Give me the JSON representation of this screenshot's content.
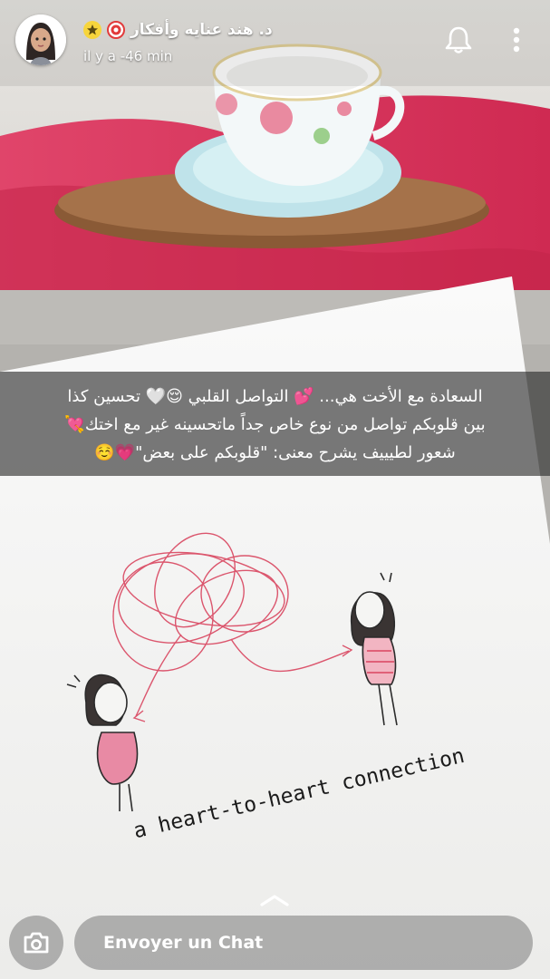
{
  "header": {
    "username": "د. هند عنايه وأفكار",
    "timestamp": "il y a -46 min",
    "avatar_icon": "bitmoji-avatar",
    "badges": [
      "target-icon",
      "star-icon"
    ],
    "actions": [
      "bell-icon",
      "more-vert-icon"
    ]
  },
  "caption": {
    "lines": [
      "السعادة مع الأخت هي... 💕 التواصل القلبي 😌🤍 تحسين كذا",
      "بين قلوبكم تواصل من نوع خاص جداً ماتحسينه غير مع اختك💘",
      "شعور لطيييف يشرح معنى: \"قلوبكم على بعض\"💗☺️"
    ]
  },
  "drawing": {
    "text": "a heart-to-heart connection"
  },
  "footer": {
    "chat_placeholder": "Envoyer un Chat",
    "camera_icon": "camera-icon",
    "swipe_icon": "chevron-up-icon"
  },
  "colors": {
    "blanket": "#d9385e",
    "card": "#f4f4f2",
    "thread": "#d9455f"
  }
}
